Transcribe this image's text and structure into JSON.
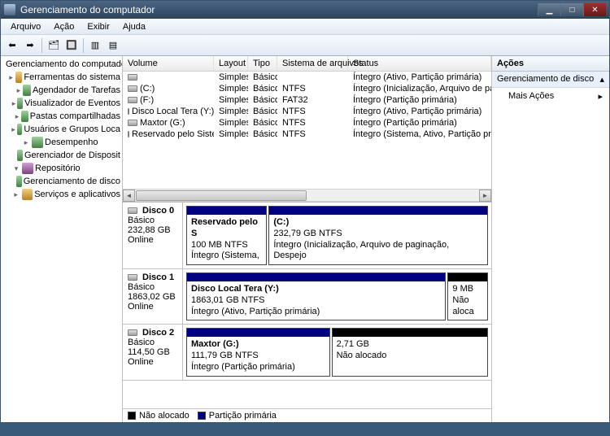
{
  "window": {
    "title": "Gerenciamento do computador"
  },
  "menubar": [
    "Arquivo",
    "Ação",
    "Exibir",
    "Ajuda"
  ],
  "tree": [
    {
      "label": "Gerenciamento do computado",
      "indent": 0,
      "exp": "",
      "icon": "root"
    },
    {
      "label": "Ferramentas do sistema",
      "indent": 1,
      "exp": "▸",
      "icon": "cfg"
    },
    {
      "label": "Agendador de Tarefas",
      "indent": 2,
      "exp": "▸",
      "icon": "leaf"
    },
    {
      "label": "Visualizador de Eventos",
      "indent": 2,
      "exp": "▸",
      "icon": "leaf"
    },
    {
      "label": "Pastas compartilhadas",
      "indent": 2,
      "exp": "▸",
      "icon": "leaf"
    },
    {
      "label": "Usuários e Grupos Loca",
      "indent": 2,
      "exp": "▸",
      "icon": "leaf"
    },
    {
      "label": "Desempenho",
      "indent": 2,
      "exp": "▸",
      "icon": "leaf"
    },
    {
      "label": "Gerenciador de Disposit",
      "indent": 2,
      "exp": "",
      "icon": "leaf"
    },
    {
      "label": "Repositório",
      "indent": 1,
      "exp": "▾",
      "icon": "store"
    },
    {
      "label": "Gerenciamento de disco",
      "indent": 2,
      "exp": "",
      "icon": "leaf"
    },
    {
      "label": "Serviços e aplicativos",
      "indent": 1,
      "exp": "▸",
      "icon": "cfg"
    }
  ],
  "vol_headers": [
    "Volume",
    "Layout",
    "Tipo",
    "Sistema de arquivos",
    "Status"
  ],
  "volumes": [
    {
      "name": "",
      "layout": "Simples",
      "type": "Básico",
      "fs": "",
      "status": "Íntegro (Ativo, Partição primária)"
    },
    {
      "name": "(C:)",
      "layout": "Simples",
      "type": "Básico",
      "fs": "NTFS",
      "status": "Íntegro (Inicialização, Arquivo de paginaç"
    },
    {
      "name": "(F:)",
      "layout": "Simples",
      "type": "Básico",
      "fs": "FAT32",
      "status": "Íntegro (Partição primária)"
    },
    {
      "name": "Disco Local  Tera (Y:)",
      "layout": "Simples",
      "type": "Básico",
      "fs": "NTFS",
      "status": "Íntegro (Ativo, Partição primária)"
    },
    {
      "name": "Maxtor (G:)",
      "layout": "Simples",
      "type": "Básico",
      "fs": "NTFS",
      "status": "Íntegro (Partição primária)"
    },
    {
      "name": "Reservado pelo Sistema",
      "layout": "Simples",
      "type": "Básico",
      "fs": "NTFS",
      "status": "Íntegro (Sistema, Ativo, Partição primária)"
    }
  ],
  "disks": [
    {
      "name": "Disco 0",
      "type": "Básico",
      "size": "232,88 GB",
      "status": "Online",
      "parts": [
        {
          "flex": 16,
          "kind": "primary",
          "title": "Reservado pelo S",
          "line2": "100 MB NTFS",
          "line3": "Íntegro (Sistema,"
        },
        {
          "flex": 44,
          "kind": "primary",
          "title": "(C:)",
          "line2": "232,79 GB NTFS",
          "line3": "Íntegro (Inicialização, Arquivo de paginação, Despejo"
        }
      ]
    },
    {
      "name": "Disco 1",
      "type": "Básico",
      "size": "1863,02 GB",
      "status": "Online",
      "parts": [
        {
          "flex": 60,
          "kind": "primary",
          "title": "Disco Local  Tera (Y:)",
          "line2": "1863,01 GB NTFS",
          "line3": "Íntegro (Ativo, Partição primária)"
        },
        {
          "flex": 9,
          "kind": "unalloc",
          "title": "",
          "line2": "9 MB",
          "line3": "Não aloca"
        }
      ]
    },
    {
      "name": "Disco 2",
      "type": "Básico",
      "size": "114,50 GB",
      "status": "Online",
      "parts": [
        {
          "flex": 33,
          "kind": "primary",
          "title": "Maxtor (G:)",
          "line2": "111,79 GB NTFS",
          "line3": "Íntegro (Partição primária)"
        },
        {
          "flex": 36,
          "kind": "unalloc",
          "title": "",
          "line2": "2,71 GB",
          "line3": "Não alocado"
        }
      ]
    }
  ],
  "legend": [
    {
      "color": "#000",
      "label": "Não alocado"
    },
    {
      "color": "#000080",
      "label": "Partição primária"
    }
  ],
  "actions": {
    "header": "Ações",
    "group": "Gerenciamento de disco",
    "items": [
      "Mais Ações"
    ]
  }
}
